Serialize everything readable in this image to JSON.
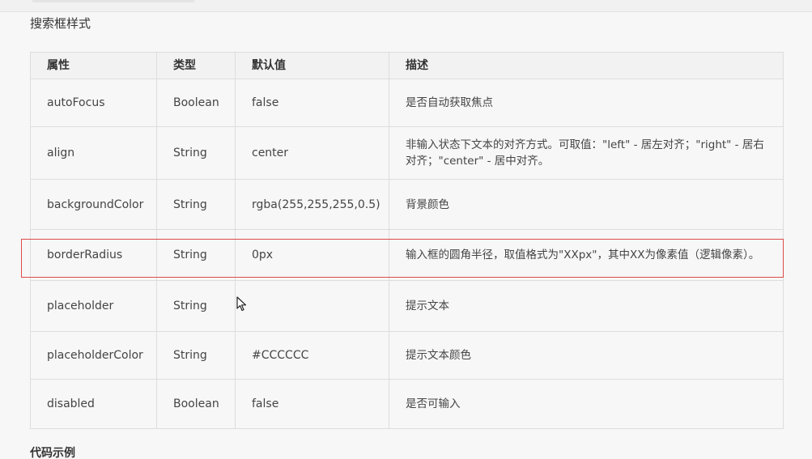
{
  "section": {
    "title": "搜索框样式"
  },
  "table": {
    "headers": [
      "属性",
      "类型",
      "默认值",
      "描述"
    ],
    "rows": [
      {
        "name": "autoFocus",
        "type": "Boolean",
        "default": "false",
        "desc": "是否自动获取焦点"
      },
      {
        "name": "align",
        "type": "String",
        "default": "center",
        "desc": "非输入状态下文本的对齐方式。可取值：\"left\" - 居左对齐；\"right\" - 居右对齐；\"center\" - 居中对齐。"
      },
      {
        "name": "backgroundColor",
        "type": "String",
        "default": "rgba(255,255,255,0.5)",
        "desc": "背景颜色"
      },
      {
        "name": "borderRadius",
        "type": "String",
        "default": "0px",
        "desc": "输入框的圆角半径，取值格式为\"XXpx\"，其中XX为像素值（逻辑像素）。"
      },
      {
        "name": "placeholder",
        "type": "String",
        "default": "",
        "desc": "提示文本"
      },
      {
        "name": "placeholderColor",
        "type": "String",
        "default": "#CCCCCC",
        "desc": "提示文本颜色"
      },
      {
        "name": "disabled",
        "type": "Boolean",
        "default": "false",
        "desc": "是否可输入"
      }
    ]
  },
  "highlight": {
    "color": "#e04a4a"
  },
  "code_section": {
    "title": "代码示例"
  },
  "icons": {
    "cursor": "mouse-pointer-icon"
  }
}
